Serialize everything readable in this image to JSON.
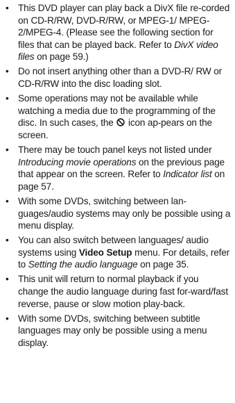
{
  "bullets": [
    {
      "text": "This DVD player can play back a DivX file re-corded on CD-R/RW, DVD-R/RW, or MPEG-1/ MPEG-2/MPEG-4. (Please see the following section for files that can be played back. Refer to ",
      "ref": "DivX video files",
      "tail": " on page 59.)"
    },
    {
      "text": "Do not insert anything other than a DVD-R/ RW or CD-R/RW into the disc loading slot."
    },
    {
      "text": "Some operations may not be available while watching a media due to the programming of the disc. In such cases, the ",
      "icon": "prohibited-icon",
      "tail": " icon ap-pears on the screen."
    },
    {
      "text": "There may be touch panel keys not listed under ",
      "ref": "Introducing movie operations",
      "tail": " on the previous page that appear on the screen. Refer to ",
      "ref2": "Indicator list",
      "tail2": " on page 57."
    },
    {
      "text": "With some DVDs, switching between lan-guages/audio systems may only be possible using a menu display."
    },
    {
      "text": "You can also switch between languages/ audio systems using ",
      "bold": "Video Setup",
      "tail": " menu. For details, refer to ",
      "ref": "Setting the audio language",
      "tail2": " on page 35."
    },
    {
      "text": "This unit will return to normal playback if you change the audio language during fast for-ward/fast reverse, pause or slow motion play-back."
    },
    {
      "text": "With some DVDs, switching between subtitle languages may only be possible using a menu display."
    }
  ],
  "bullet_glyph": "•"
}
